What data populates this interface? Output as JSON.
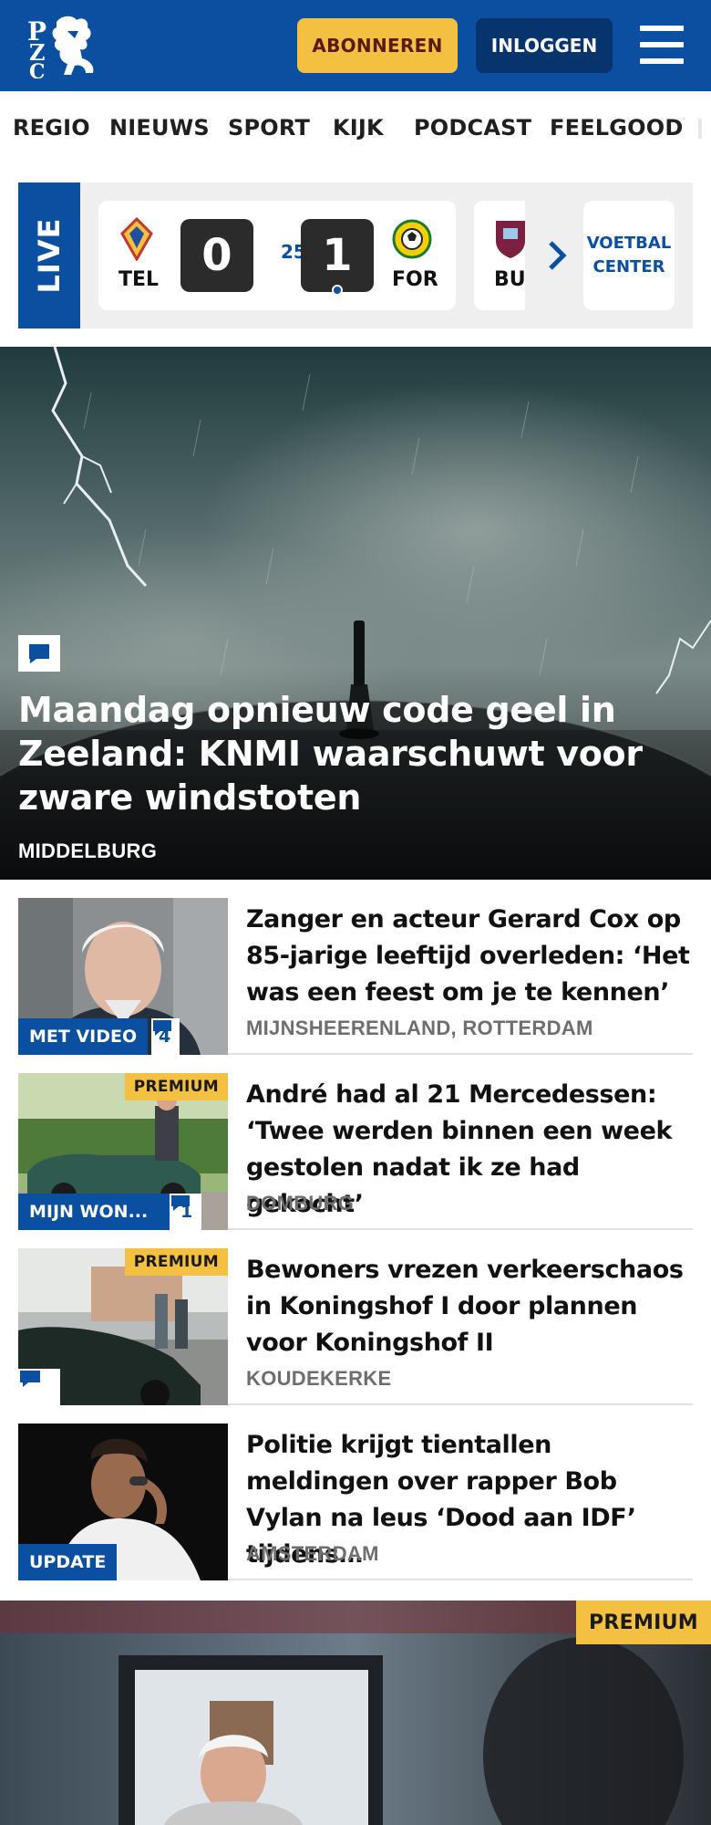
{
  "header": {
    "logo_alt": "PZC",
    "subscribe_label": "ABONNEREN",
    "login_label": "INLOGGEN"
  },
  "nav": {
    "items": [
      "REGIO",
      "NIEUWS",
      "SPORT",
      "KIJK",
      "PODCAST",
      "FEELGOOD"
    ]
  },
  "live": {
    "label": "LIVE",
    "match": {
      "home_abbr": "TEL",
      "home_score": "0",
      "minute": "25'",
      "away_score": "1",
      "away_abbr": "FOR"
    },
    "match2_abbr": "BU",
    "voetbal_center": {
      "line1": "VOETBAL",
      "line2": "CENTER"
    }
  },
  "hero": {
    "title": "Maandag opnieuw code geel in Zeeland: KNMI waarschuwt voor zware windstoten",
    "location": "MIDDELBURG"
  },
  "articles": [
    {
      "title": "Zanger en acteur Gerard Cox op 85-jarige leeftijd overleden: ‘Het was een feest om je te kennen’",
      "location": "MIJNSHEERENLAND, ROTTERDAM",
      "badge": "MET VIDEO",
      "comments": "4"
    },
    {
      "title": "André had al 21 Mercedessen: ‘Twee werden binnen een week gestolen nadat ik ze had gekocht’",
      "location": "DOMBURG",
      "badge": "MIJN WON...",
      "comments": "1",
      "premium": "PREMIUM"
    },
    {
      "title": "Bewoners vrezen verkeerschaos in Koningshof I door plannen voor Koningshof II",
      "location": "KOUDEKERKE",
      "premium": "PREMIUM"
    },
    {
      "title": "Politie krijgt tientallen meldingen over rapper Bob Vylan na leus ‘Dood aan IDF’ tijdens…",
      "location": "AMSTERDAM",
      "badge": "UPDATE"
    }
  ],
  "hero2": {
    "premium": "PREMIUM"
  },
  "colors": {
    "brand_blue": "#0a4fa0",
    "dark_blue": "#08346e",
    "accent_yellow": "#f4c042"
  },
  "icons": [
    "pzc-lion-logo",
    "hamburger-menu-icon",
    "comment-icon",
    "chevron-right-icon",
    "telstar-crest",
    "fortuna-crest",
    "burnley-crest"
  ]
}
